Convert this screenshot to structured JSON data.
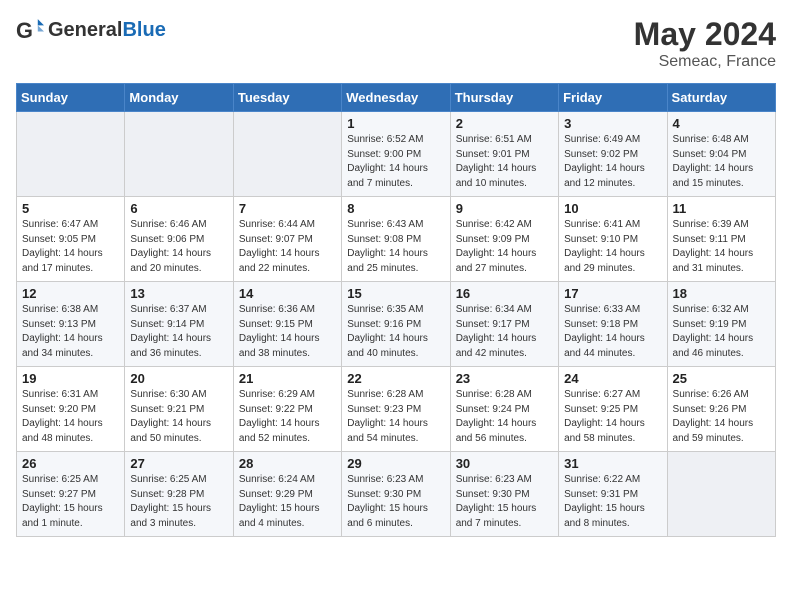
{
  "header": {
    "logo_general": "General",
    "logo_blue": "Blue",
    "month_year": "May 2024",
    "location": "Semeac, France"
  },
  "days_of_week": [
    "Sunday",
    "Monday",
    "Tuesday",
    "Wednesday",
    "Thursday",
    "Friday",
    "Saturday"
  ],
  "weeks": [
    [
      {
        "day": null
      },
      {
        "day": null
      },
      {
        "day": null
      },
      {
        "day": "1",
        "sunrise": "6:52 AM",
        "sunset": "9:00 PM",
        "daylight": "14 hours and 7 minutes."
      },
      {
        "day": "2",
        "sunrise": "6:51 AM",
        "sunset": "9:01 PM",
        "daylight": "14 hours and 10 minutes."
      },
      {
        "day": "3",
        "sunrise": "6:49 AM",
        "sunset": "9:02 PM",
        "daylight": "14 hours and 12 minutes."
      },
      {
        "day": "4",
        "sunrise": "6:48 AM",
        "sunset": "9:04 PM",
        "daylight": "14 hours and 15 minutes."
      }
    ],
    [
      {
        "day": "5",
        "sunrise": "6:47 AM",
        "sunset": "9:05 PM",
        "daylight": "14 hours and 17 minutes."
      },
      {
        "day": "6",
        "sunrise": "6:46 AM",
        "sunset": "9:06 PM",
        "daylight": "14 hours and 20 minutes."
      },
      {
        "day": "7",
        "sunrise": "6:44 AM",
        "sunset": "9:07 PM",
        "daylight": "14 hours and 22 minutes."
      },
      {
        "day": "8",
        "sunrise": "6:43 AM",
        "sunset": "9:08 PM",
        "daylight": "14 hours and 25 minutes."
      },
      {
        "day": "9",
        "sunrise": "6:42 AM",
        "sunset": "9:09 PM",
        "daylight": "14 hours and 27 minutes."
      },
      {
        "day": "10",
        "sunrise": "6:41 AM",
        "sunset": "9:10 PM",
        "daylight": "14 hours and 29 minutes."
      },
      {
        "day": "11",
        "sunrise": "6:39 AM",
        "sunset": "9:11 PM",
        "daylight": "14 hours and 31 minutes."
      }
    ],
    [
      {
        "day": "12",
        "sunrise": "6:38 AM",
        "sunset": "9:13 PM",
        "daylight": "14 hours and 34 minutes."
      },
      {
        "day": "13",
        "sunrise": "6:37 AM",
        "sunset": "9:14 PM",
        "daylight": "14 hours and 36 minutes."
      },
      {
        "day": "14",
        "sunrise": "6:36 AM",
        "sunset": "9:15 PM",
        "daylight": "14 hours and 38 minutes."
      },
      {
        "day": "15",
        "sunrise": "6:35 AM",
        "sunset": "9:16 PM",
        "daylight": "14 hours and 40 minutes."
      },
      {
        "day": "16",
        "sunrise": "6:34 AM",
        "sunset": "9:17 PM",
        "daylight": "14 hours and 42 minutes."
      },
      {
        "day": "17",
        "sunrise": "6:33 AM",
        "sunset": "9:18 PM",
        "daylight": "14 hours and 44 minutes."
      },
      {
        "day": "18",
        "sunrise": "6:32 AM",
        "sunset": "9:19 PM",
        "daylight": "14 hours and 46 minutes."
      }
    ],
    [
      {
        "day": "19",
        "sunrise": "6:31 AM",
        "sunset": "9:20 PM",
        "daylight": "14 hours and 48 minutes."
      },
      {
        "day": "20",
        "sunrise": "6:30 AM",
        "sunset": "9:21 PM",
        "daylight": "14 hours and 50 minutes."
      },
      {
        "day": "21",
        "sunrise": "6:29 AM",
        "sunset": "9:22 PM",
        "daylight": "14 hours and 52 minutes."
      },
      {
        "day": "22",
        "sunrise": "6:28 AM",
        "sunset": "9:23 PM",
        "daylight": "14 hours and 54 minutes."
      },
      {
        "day": "23",
        "sunrise": "6:28 AM",
        "sunset": "9:24 PM",
        "daylight": "14 hours and 56 minutes."
      },
      {
        "day": "24",
        "sunrise": "6:27 AM",
        "sunset": "9:25 PM",
        "daylight": "14 hours and 58 minutes."
      },
      {
        "day": "25",
        "sunrise": "6:26 AM",
        "sunset": "9:26 PM",
        "daylight": "14 hours and 59 minutes."
      }
    ],
    [
      {
        "day": "26",
        "sunrise": "6:25 AM",
        "sunset": "9:27 PM",
        "daylight": "15 hours and 1 minute."
      },
      {
        "day": "27",
        "sunrise": "6:25 AM",
        "sunset": "9:28 PM",
        "daylight": "15 hours and 3 minutes."
      },
      {
        "day": "28",
        "sunrise": "6:24 AM",
        "sunset": "9:29 PM",
        "daylight": "15 hours and 4 minutes."
      },
      {
        "day": "29",
        "sunrise": "6:23 AM",
        "sunset": "9:30 PM",
        "daylight": "15 hours and 6 minutes."
      },
      {
        "day": "30",
        "sunrise": "6:23 AM",
        "sunset": "9:30 PM",
        "daylight": "15 hours and 7 minutes."
      },
      {
        "day": "31",
        "sunrise": "6:22 AM",
        "sunset": "9:31 PM",
        "daylight": "15 hours and 8 minutes."
      },
      {
        "day": null
      }
    ]
  ]
}
